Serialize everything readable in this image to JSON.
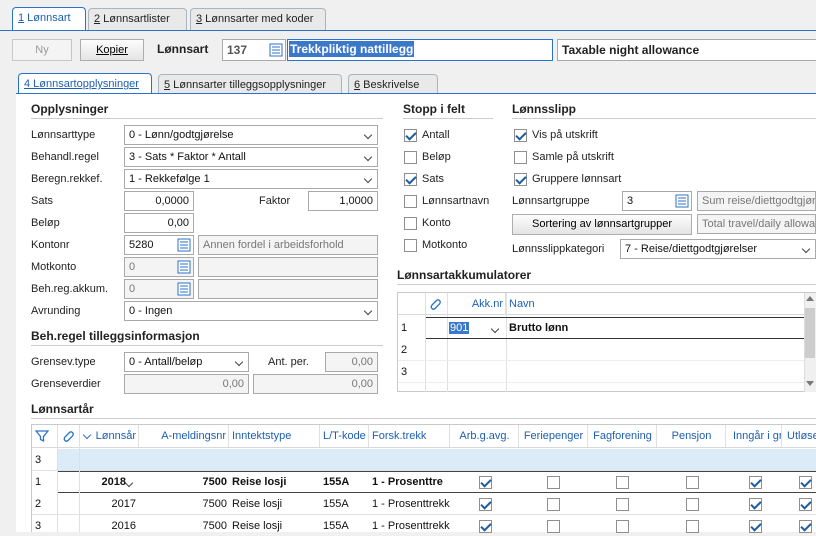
{
  "top_tabs": [
    {
      "key": "1",
      "label": " Lønnsart"
    },
    {
      "key": "2",
      "label": " Lønnsartlister"
    },
    {
      "key": "3",
      "label": " Lønnsarter med koder"
    }
  ],
  "toolbar": {
    "new_label": "Ny",
    "copy_label": "Kopier",
    "lonnsart_label": "Lønnsart",
    "lonnsart_no": "137",
    "name_no": "Trekkpliktig nattillegg",
    "name_en": "Taxable night allowance"
  },
  "sub_tabs": [
    {
      "key": "4",
      "label": " Lønnsartopplysninger"
    },
    {
      "key": "5",
      "label": " Lønnsarter tilleggsopplysninger"
    },
    {
      "key": "6",
      "label": " Beskrivelse"
    }
  ],
  "opplysninger": {
    "title": "Opplysninger",
    "lonnsarttype_label": "Lønnsarttype",
    "lonnsarttype": "0 - Lønn/godtgjørelse",
    "behandl_label": "Behandl.regel",
    "behandl": "3 - Sats * Faktor * Antall",
    "beregn_label": "Beregn.rekkef.",
    "beregn": "1 - Rekkefølge 1",
    "sats_label": "Sats",
    "sats": "0,0000",
    "faktor_label": "Faktor",
    "faktor": "1,0000",
    "belop_label": "Beløp",
    "belop": "0,00",
    "kontonr_label": "Kontonr",
    "kontonr": "5280",
    "kontonr_desc": "Annen fordel i arbeidsforhold",
    "motkonto_label": "Motkonto",
    "motkonto": "0",
    "behreg_label": "Beh.reg.akkum.",
    "behreg": "0",
    "avrunding_label": "Avrunding",
    "avrunding": "0 - Ingen"
  },
  "tillegg": {
    "title": "Beh.regel tilleggsinformasjon",
    "grensev_label": "Grensev.type",
    "grensev": "0 - Antall/beløp",
    "antper_label": "Ant. per.",
    "antper": "0,00",
    "grenseverdier_label": "Grenseverdier",
    "grense1": "0,00",
    "grense2": "0,00"
  },
  "stopp": {
    "title": "Stopp i felt",
    "items": [
      {
        "label": "Antall",
        "checked": true
      },
      {
        "label": "Beløp",
        "checked": false
      },
      {
        "label": "Sats",
        "checked": true
      },
      {
        "label": "Lønnsartnavn",
        "checked": false
      },
      {
        "label": "Konto",
        "checked": false
      },
      {
        "label": "Motkonto",
        "checked": false
      }
    ]
  },
  "lonnsslipp": {
    "title": "Lønnsslipp",
    "vis": "Vis på utskrift",
    "samle": "Samle på utskrift",
    "grupper": "Gruppere lønnsart",
    "gruppe_label": "Lønnsartgruppe",
    "gruppe": "3",
    "gruppe_desc": "Sum reise/diettgodtgjørelse",
    "sort_button": "Sortering av lønnsartgrupper",
    "sort_desc": "Total travel/daily allowance",
    "kategori_label": "Lønnsslippkategori",
    "kategori": "7 - Reise/diettgodtgjørelser"
  },
  "akkumulatorer": {
    "title": "Lønnsartakkumulatorer",
    "col_akk": "Akk.nr",
    "col_navn": "Navn",
    "rows": [
      {
        "n": "1",
        "akk": "901",
        "navn": "Brutto lønn"
      },
      {
        "n": "2",
        "akk": "",
        "navn": ""
      },
      {
        "n": "3",
        "akk": "",
        "navn": ""
      }
    ]
  },
  "lonnsartar": {
    "title": "Lønnsartår",
    "cols": [
      "Lønnsår",
      "A-meldingsnr",
      "Inntektstype",
      "L/T-kode",
      "Forsk.trekk",
      "Arb.g.avg.",
      "Feriepenger",
      "Fagforening",
      "Pensjon",
      "Inngår i gr",
      "Utløse"
    ],
    "count": "3",
    "rows": [
      {
        "n": "1",
        "year": "2018",
        "amn": "7500",
        "type": "Reise losji",
        "lt": "155A",
        "forsk": "1 - Prosenttre",
        "arb": true,
        "fer": false,
        "fag": false,
        "pen": false,
        "inn": true,
        "utl": true
      },
      {
        "n": "2",
        "year": "2017",
        "amn": "7500",
        "type": "Reise losji",
        "lt": "155A",
        "forsk": "1 - Prosenttrekk",
        "arb": true,
        "fer": false,
        "fag": false,
        "pen": false,
        "inn": true,
        "utl": true
      },
      {
        "n": "3",
        "year": "2016",
        "amn": "7500",
        "type": "Reise losji",
        "lt": "155A",
        "forsk": "1 - Prosenttrekk",
        "arb": true,
        "fer": false,
        "fag": false,
        "pen": false,
        "inn": true,
        "utl": true
      }
    ]
  },
  "colors": {
    "accent": "#2b73c9",
    "selection": "#3a78c9",
    "row_highlight": "#dcebf8"
  }
}
